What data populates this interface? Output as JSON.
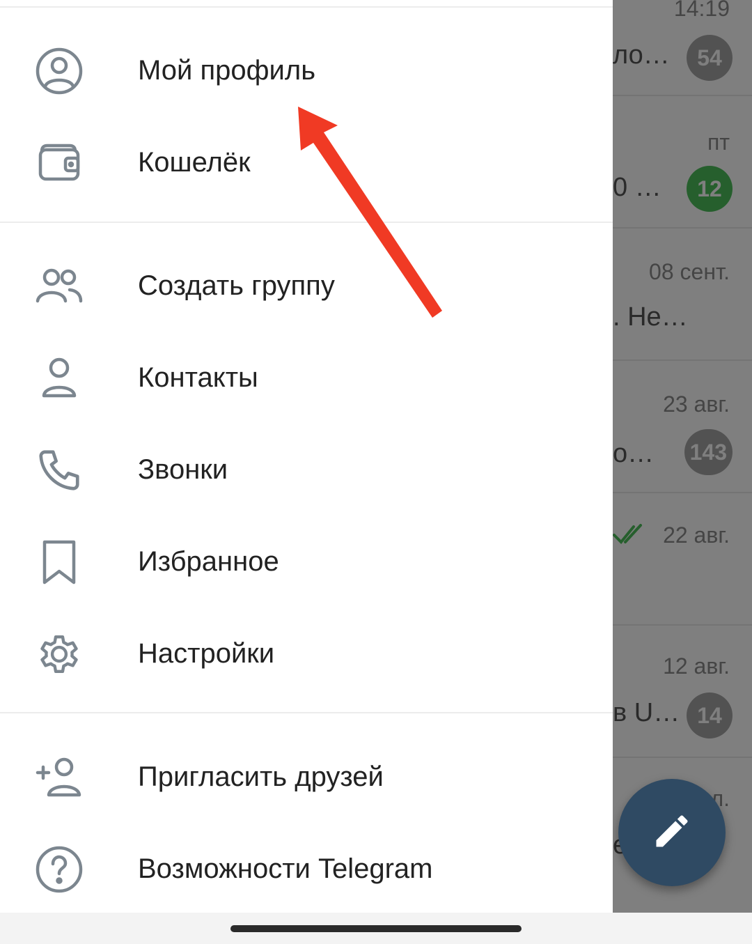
{
  "drawer": {
    "items": [
      {
        "id": "profile",
        "label": "Мой профиль",
        "icon": "user-circle-icon"
      },
      {
        "id": "wallet",
        "label": "Кошелёк",
        "icon": "wallet-icon"
      },
      {
        "id": "new-group",
        "label": "Создать группу",
        "icon": "group-icon"
      },
      {
        "id": "contacts",
        "label": "Контакты",
        "icon": "person-icon"
      },
      {
        "id": "calls",
        "label": "Звонки",
        "icon": "phone-icon"
      },
      {
        "id": "saved",
        "label": "Избранное",
        "icon": "bookmark-icon"
      },
      {
        "id": "settings",
        "label": "Настройки",
        "icon": "gear-icon"
      },
      {
        "id": "invite",
        "label": "Пригласить друзей",
        "icon": "add-user-icon"
      },
      {
        "id": "features",
        "label": "Возможности Telegram",
        "icon": "question-circle-icon"
      }
    ]
  },
  "chat_list": {
    "rows": [
      {
        "time": "14:19",
        "snippet": "ло…",
        "badge": "54",
        "badge_color": "#a5a5a5"
      },
      {
        "time": "пт",
        "snippet": "0 …",
        "badge": "12",
        "badge_color": "#4cbf5a"
      },
      {
        "time": "08 сент.",
        "snippet": ". Не…",
        "badge": "",
        "badge_color": ""
      },
      {
        "time": "23 авг.",
        "snippet": "о…",
        "badge": "143",
        "badge_color": "#a5a5a5"
      },
      {
        "time": "22 авг.",
        "snippet": "",
        "badge": "",
        "badge_color": "",
        "read_check": "double-check-icon"
      },
      {
        "time": "12 авг.",
        "snippet": "в U…",
        "badge": "14",
        "badge_color": "#a5a5a5"
      },
      {
        "time": "л.",
        "snippet": "е",
        "badge": "",
        "badge_color": ""
      }
    ]
  },
  "fab": {
    "icon": "pencil-icon",
    "color": "#2f4a63"
  },
  "annotation": {
    "type": "arrow",
    "color": "#f03a24",
    "points_to": "Мой профиль"
  },
  "colors": {
    "icon_gray": "#7c868f",
    "text": "#222222",
    "scrim": "rgba(0,0,0,0.5)"
  }
}
